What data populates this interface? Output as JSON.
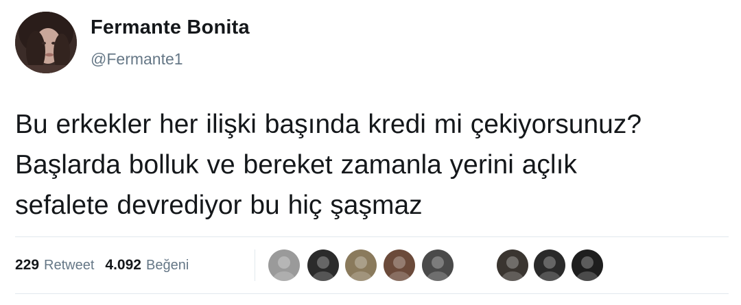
{
  "user": {
    "display_name": "Fermante Bonita",
    "handle": "@Fermante1",
    "avatar_icon": "profile-photo"
  },
  "tweet": {
    "lines": [
      "Bu erkekler her ilişki  başında  kredi mi çekiyorsunuz?",
      "Başlarda  bolluk ve bereket  zamanla yerini açlık",
      "sefalete  devrediyor bu hiç  şaşmaz"
    ]
  },
  "stats": {
    "retweet_count": "229",
    "retweet_label": "Retweet",
    "like_count": "4.092",
    "like_label": "Beğeni"
  },
  "likers": [
    {
      "name": "liker-avatar-1",
      "color": "#9a9a9a"
    },
    {
      "name": "liker-avatar-2",
      "color": "#2b2b2b"
    },
    {
      "name": "liker-avatar-3",
      "color": "#8a7a5c"
    },
    {
      "name": "liker-avatar-4",
      "color": "#6b4a3a"
    },
    {
      "name": "liker-avatar-5",
      "color": "#4a4a4a"
    },
    {
      "name": "liker-avatar-6",
      "color": "#3a3530"
    },
    {
      "name": "liker-avatar-7",
      "color": "#2a2a2a"
    },
    {
      "name": "liker-avatar-8",
      "color": "#1e1e1e"
    },
    {
      "name": "liker-avatar-9",
      "color": "#5a4e48"
    }
  ],
  "colors": {
    "text": "#14171a",
    "secondary": "#657786",
    "divider": "#e1e8ed"
  }
}
